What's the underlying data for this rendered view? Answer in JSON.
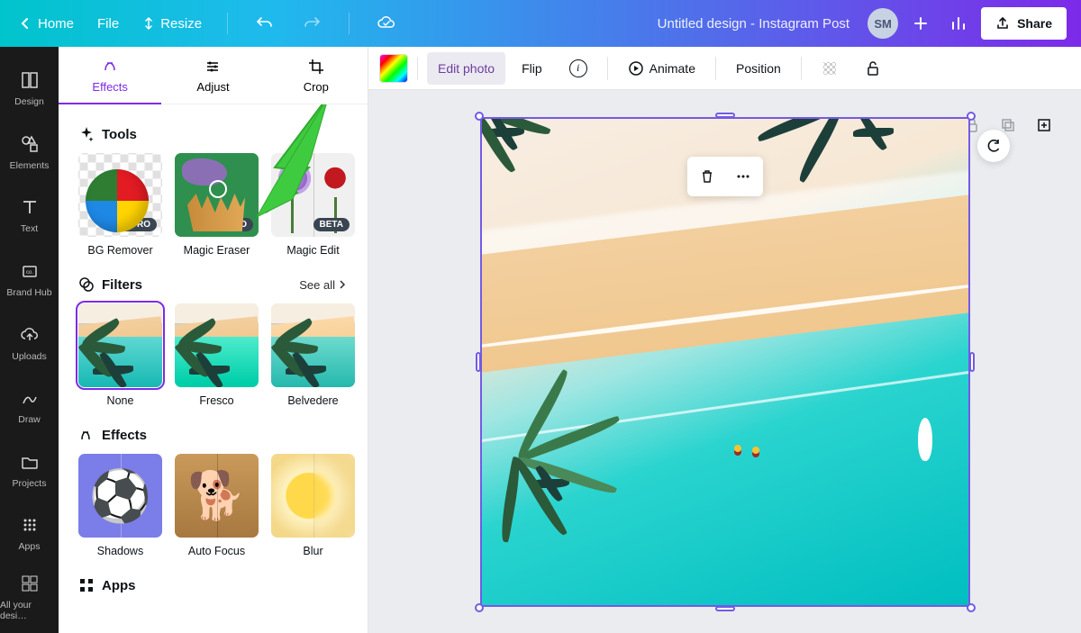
{
  "header": {
    "home": "Home",
    "file": "File",
    "resize": "Resize",
    "doc_title": "Untitled design - Instagram Post",
    "avatar_initials": "SM",
    "share": "Share"
  },
  "nav": {
    "items": [
      {
        "label": "Design"
      },
      {
        "label": "Elements"
      },
      {
        "label": "Text"
      },
      {
        "label": "Brand Hub"
      },
      {
        "label": "Uploads"
      },
      {
        "label": "Draw"
      },
      {
        "label": "Projects"
      },
      {
        "label": "Apps"
      },
      {
        "label": "All your desi…"
      }
    ]
  },
  "panel": {
    "tabs": {
      "effects": "Effects",
      "adjust": "Adjust",
      "crop": "Crop"
    },
    "tools_heading": "Tools",
    "tools": [
      {
        "label": "BG Remover",
        "badge": "PRO"
      },
      {
        "label": "Magic Eraser",
        "badge": "PRO"
      },
      {
        "label": "Magic Edit",
        "badge": "BETA"
      }
    ],
    "filters_heading": "Filters",
    "see_all": "See all",
    "filters": [
      {
        "label": "None"
      },
      {
        "label": "Fresco"
      },
      {
        "label": "Belvedere"
      }
    ],
    "effects_heading": "Effects",
    "effects": [
      {
        "label": "Shadows"
      },
      {
        "label": "Auto Focus"
      },
      {
        "label": "Blur"
      }
    ],
    "apps_heading": "Apps"
  },
  "toolbar": {
    "edit_photo": "Edit photo",
    "flip": "Flip",
    "animate": "Animate",
    "position": "Position"
  },
  "badges": {
    "pro": "PRO",
    "beta": "BETA"
  }
}
